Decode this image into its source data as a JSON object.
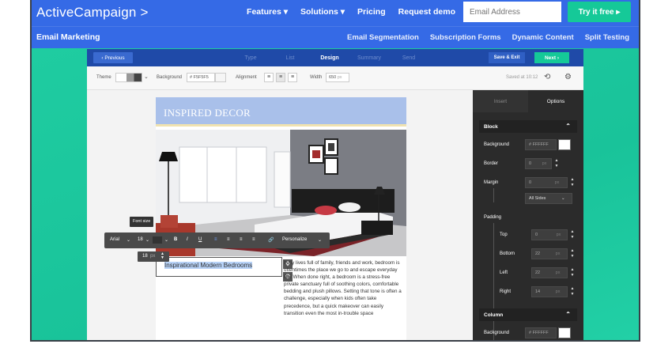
{
  "site": {
    "logo": "ActiveCampaign >",
    "nav": [
      "Features ▾",
      "Solutions ▾",
      "Pricing",
      "Request demo"
    ],
    "email_placeholder": "Email Address",
    "cta": "Try it free ▸"
  },
  "subnav": {
    "title": "Email Marketing",
    "links": [
      "Email Segmentation",
      "Subscription Forms",
      "Dynamic Content",
      "Split Testing"
    ]
  },
  "stepbar": {
    "previous": "‹ Previous",
    "steps": [
      "Type",
      "List",
      "Design",
      "Summary",
      "Send"
    ],
    "active_step": "Design",
    "save_exit": "Save & Exit",
    "next": "Next ›"
  },
  "toolbar": {
    "theme_label": "Theme",
    "background_label": "Background",
    "background_value": "# F5F5F5",
    "alignment_label": "Alignment",
    "width_label": "Width",
    "width_value": "650",
    "width_unit": "px",
    "saved_text": "Saved at 10:12"
  },
  "email": {
    "header_title": "INSPIRED DECOR",
    "selected_heading": "Inspirational Modern Bedrooms",
    "body": "busy lives full of family, friends and work, bedroom is oftentimes the place we go to and escape everyday life. When done right, a bedroom is a stress-free private sanctuary full of soothing colors, comfortable bedding and plush pillows. Setting that tone is often a challenge, especially when kids often take precedence, but a quick makeover can easily transition even the most in-trouble space"
  },
  "rte": {
    "font": "Arial",
    "size": "18",
    "size_chevron": "⌄",
    "bold": "B",
    "italic": "I",
    "underline": "U",
    "personalize": "Personalize",
    "tooltip": "Font size",
    "size_box_value": "18",
    "size_box_unit": "px"
  },
  "panel": {
    "tabs": [
      "Insert",
      "Options"
    ],
    "active_tab": "Options",
    "block": {
      "title": "Block",
      "background_label": "Background",
      "background_value": "# FFFFFF",
      "border_label": "Border",
      "border_value": "0",
      "margin_label": "Margin",
      "margin_value": "0",
      "margin_sides": "All Sides",
      "padding_label": "Padding",
      "top_label": "Top",
      "top_value": "0",
      "bottom_label": "Bottom",
      "bottom_value": "22",
      "left_label": "Left",
      "left_value": "22",
      "right_label": "Right",
      "right_value": "14",
      "unit": "px"
    },
    "column": {
      "title": "Column",
      "background_label": "Background",
      "background_value": "# FFFFFF"
    }
  },
  "colors": {
    "brand_blue": "#356ae6",
    "teal": "#1fcca1",
    "cta_green": "#15c998",
    "stepbar": "#1f4aa8",
    "panel_dark": "#2b2b2b"
  }
}
